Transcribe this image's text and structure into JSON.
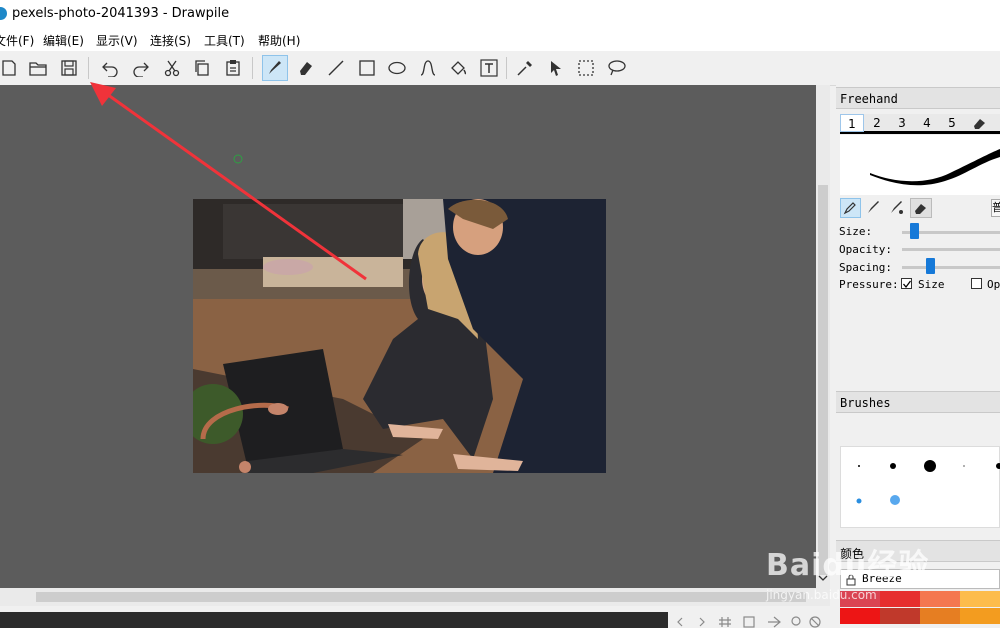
{
  "window": {
    "title": "pexels-photo-2041393 - Drawpile"
  },
  "menubar": {
    "items": [
      "文件(F)",
      "编辑(E)",
      "显示(V)",
      "连接(S)",
      "工具(T)",
      "帮助(H)"
    ]
  },
  "toolbar": {
    "file_tools": [
      "new-icon",
      "open-icon",
      "save-icon"
    ],
    "edit_tools": [
      "undo-icon",
      "redo-icon",
      "cut-icon",
      "copy-icon",
      "paste-icon"
    ],
    "draw_tools": [
      "freehand-icon",
      "eraser-icon",
      "line-icon",
      "rectangle-icon",
      "ellipse-icon",
      "bezier-icon",
      "fill-icon",
      "text-icon",
      "color-picker-icon",
      "pointer-icon",
      "select-rect-icon",
      "lasso-icon"
    ],
    "active_tool": "freehand-icon"
  },
  "annotation": {
    "arrow_color": "#f0333a"
  },
  "freehand_panel": {
    "title": "Freehand",
    "tabs": [
      "1",
      "2",
      "3",
      "4",
      "5"
    ],
    "active_tab": "1",
    "size_label": "Size:",
    "opacity_label": "Opacity:",
    "spacing_label": "Spacing:",
    "pressure_label": "Pressure:",
    "pressure_size_label": "Size",
    "pressure_size_checked": true,
    "pressure_opacity_label": "Op",
    "pressure_opacity_checked": false,
    "extra_button_label": "普"
  },
  "brushes_panel": {
    "title": "Brushes"
  },
  "palette_panel": {
    "title": "颜色",
    "palette_name": "Breeze",
    "swatches": [
      "#da4453",
      "#e62e2e",
      "#f47750",
      "#fdbc4b",
      "#ed1515",
      "#c0392b",
      "#e67e22",
      "#f39c1f"
    ]
  },
  "watermark": {
    "text": "Baidu经验",
    "subtext": "jingyan.baidu.com"
  },
  "accent": "#1679d8"
}
